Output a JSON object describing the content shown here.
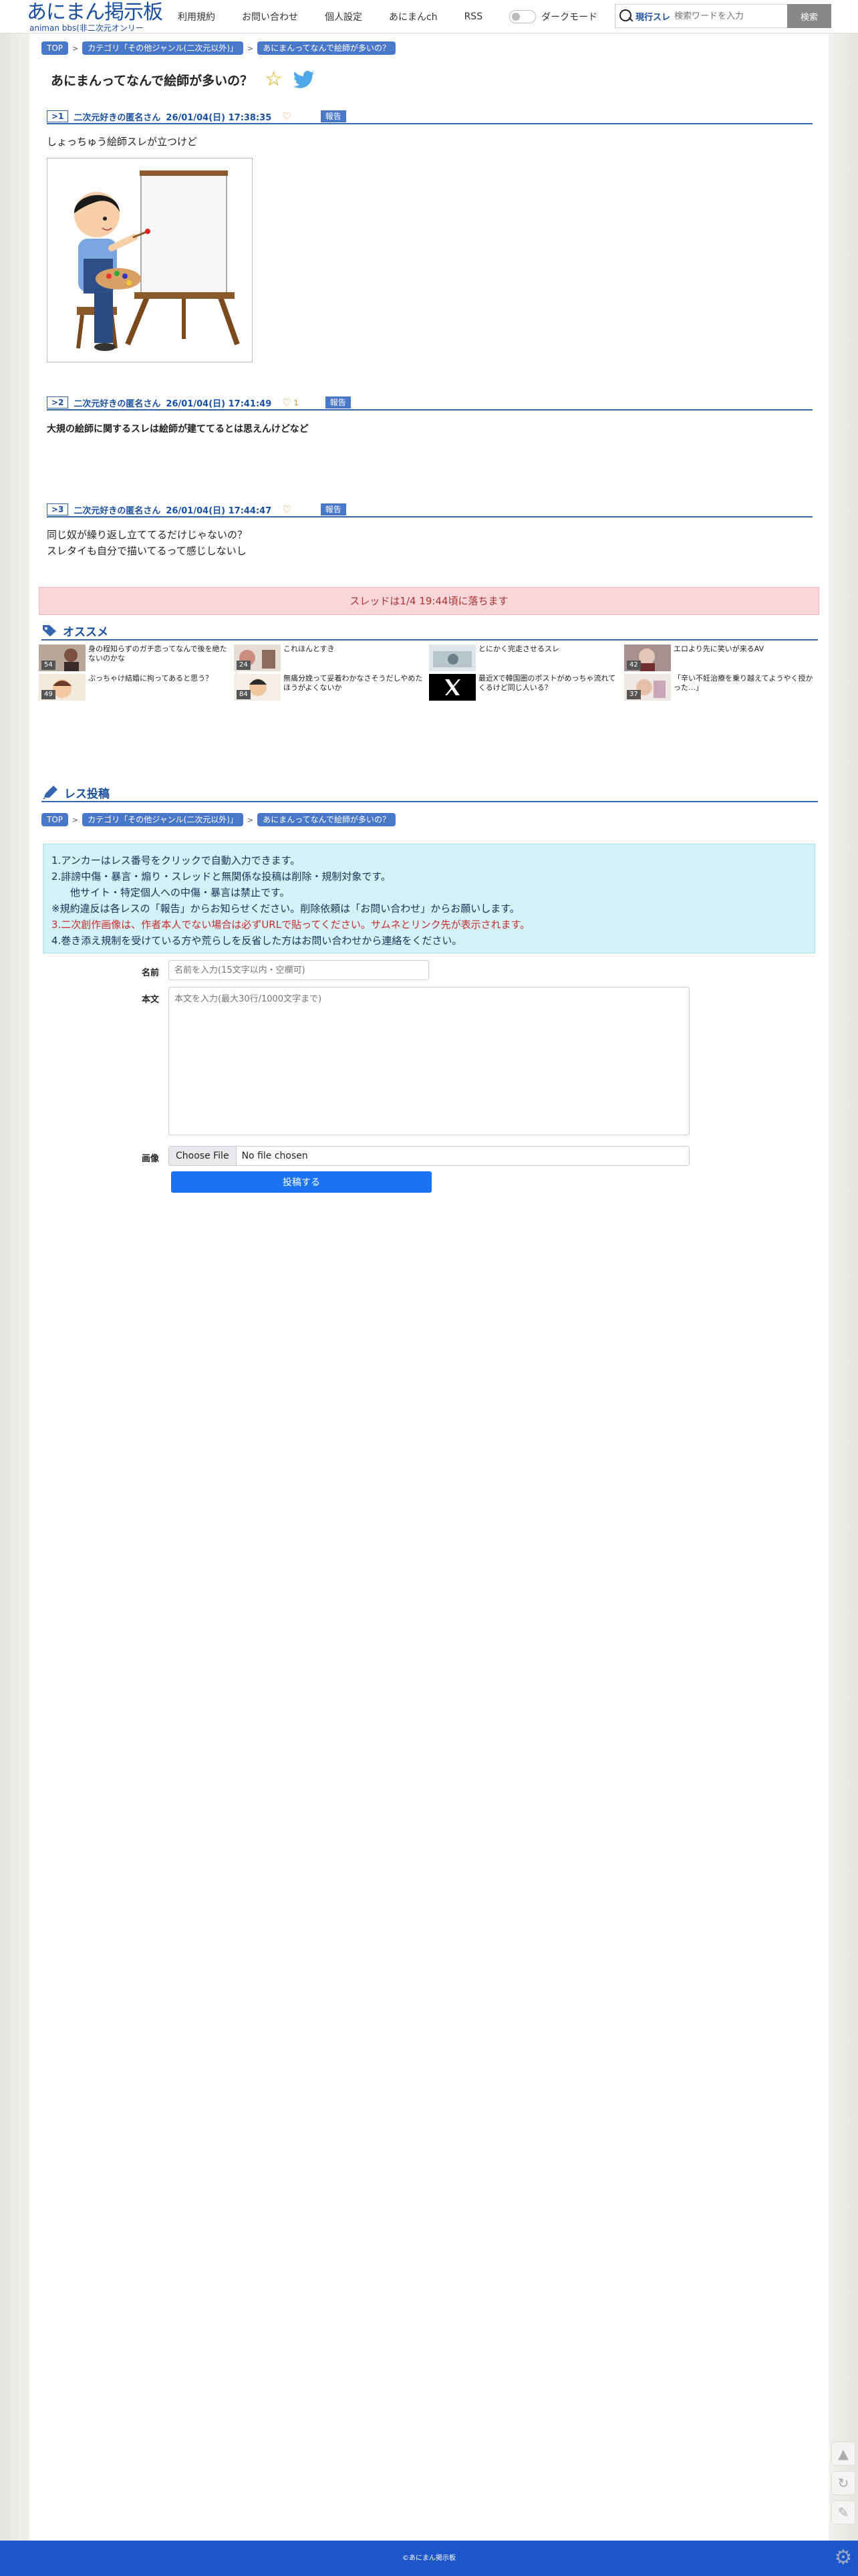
{
  "header": {
    "logo_title": "あにまん掲示板",
    "logo_sub": "animan bbs(非二次元オンリー",
    "nav": [
      "利用規約",
      "お問い合わせ",
      "個人設定",
      "あにまんch",
      "RSS"
    ],
    "dark_mode_label": "ダークモード",
    "search_scope": "現行スレ",
    "search_placeholder": "検索ワードを入力",
    "search_button": "検索"
  },
  "breadcrumb": [
    "TOP",
    "カテゴリ「その他ジャンル(二次元以外)」",
    "あにまんってなんで絵師が多いの？"
  ],
  "thread_title": "あにまんってなんで絵師が多いの？",
  "posts": [
    {
      "no": ">1",
      "name": "二次元好きの匿名さん",
      "date": "26/01/04(日) 17:38:35",
      "likes": "",
      "report": "報告",
      "lines": [
        "しょっちゅう絵師スレが立つけど"
      ]
    },
    {
      "no": ">2",
      "name": "二次元好きの匿名さん",
      "date": "26/01/04(日) 17:41:49",
      "likes": "1",
      "report": "報告",
      "lines": [
        "大規の絵師に関するスレは絵師が建ててるとは思えんけどなど"
      ]
    },
    {
      "no": ">3",
      "name": "二次元好きの匿名さん",
      "date": "26/01/04(日) 17:44:47",
      "likes": "",
      "report": "報告",
      "lines": [
        "同じ奴が繰り返し立ててるだけじゃないの？",
        "スレタイも自分で描いてるって感じしないし"
      ]
    }
  ],
  "expire_notice": "スレッドは1/4 19:44頃に落ちます",
  "recommend": {
    "title": "オススメ",
    "items": [
      {
        "text": "身の程知らずのガチ恋ってなんで後を絶たないのかな",
        "count": "54"
      },
      {
        "text": "これほんとすき",
        "count": "24"
      },
      {
        "text": "とにかく完走させるスレ",
        "count": ""
      },
      {
        "text": "エロより先に笑いが来るAV",
        "count": "42"
      },
      {
        "text": "ぶっちゃけ結婚に拘ってあると思う？",
        "count": "49"
      },
      {
        "text": "無痛分娩って妥着わかなさそうだしやめたほうがよくないか",
        "count": "84"
      },
      {
        "text": "最近Xで韓国圏のポストがめっちゃ流れてくるけど同じ人いる？",
        "count": ""
      },
      {
        "text": "「辛い不妊治療を乗り越えてようやく授かった…」",
        "count": "37"
      }
    ]
  },
  "reply": {
    "title": "レス投稿",
    "rules": [
      "1.アンカーはレス番号をクリックで自動入力できます。",
      "2.誹謗中傷・暴言・煽り・スレッドと無関係な投稿は削除・規制対象です。",
      "他サイト・特定個人への中傷・暴言は禁止です。",
      "※規約違反は各レスの「報告」からお知らせください。削除依頼は「お問い合わせ」からお願いします。",
      "3.二次創作画像は、作者本人でない場合は必ずURLで貼ってください。サムネとリンク先が表示されます。",
      "4.巻き添え規制を受けている方や荒らしを反省した方はお問い合わせから連絡をください。"
    ],
    "name_label": "名前",
    "name_placeholder": "名前を入力(15文字以内・空欄可)",
    "body_label": "本文",
    "body_placeholder": "本文を入力(最大30行/1000文字まで)",
    "image_label": "画像",
    "choose_file": "Choose File",
    "no_file": "No file chosen",
    "submit": "投稿する"
  },
  "footer": "©あにまん掲示板",
  "colors": {
    "brand_blue": "#1a4fa0",
    "accent_blue": "#4a78c8",
    "footer_blue": "#1d56c9",
    "submit_blue": "#1a73f0",
    "alert_pink": "#f9d7d9",
    "rules_cyan": "#d2f2f8"
  }
}
